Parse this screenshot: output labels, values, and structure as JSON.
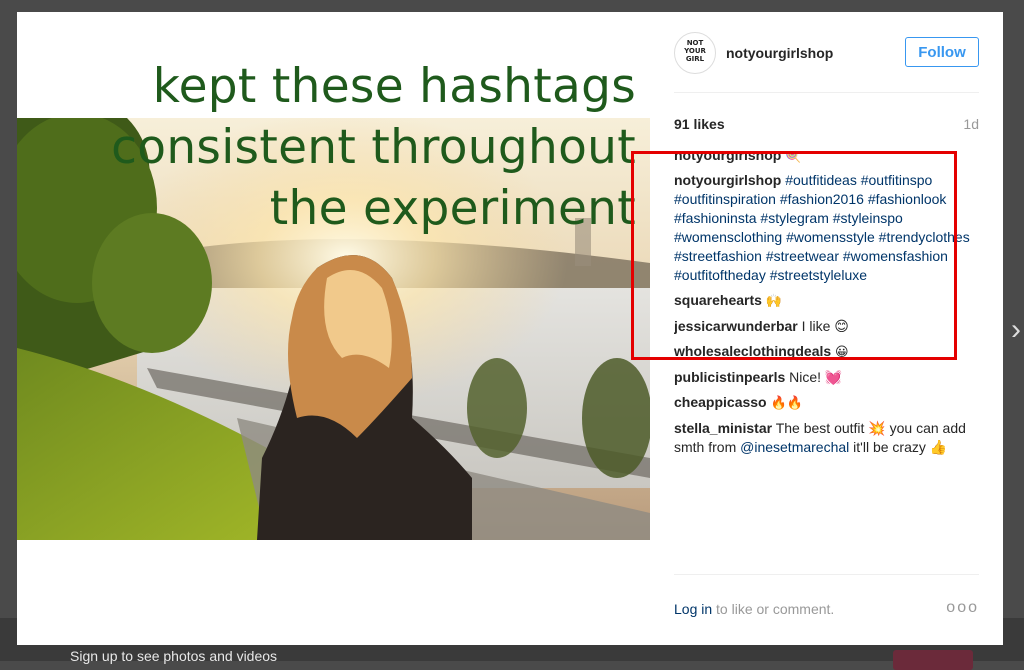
{
  "overlay_text": "kept these hashtags consistent throughout the experiment",
  "overlay_lines": [
    "kept these hashtags",
    "consistent throughout",
    "the experiment"
  ],
  "post": {
    "avatar_text": "NOT YOUR GIRL",
    "username": "notyourgirlshop",
    "follow_label": "Follow",
    "likes": "91 likes",
    "age": "1d"
  },
  "first_comment": {
    "user": "notyourgirlshop",
    "text": "🍭"
  },
  "caption": {
    "user": "notyourgirlshop",
    "hashtags": [
      "#outfitideas",
      "#outfitinspo",
      "#outfitinspiration",
      "#fashion2016",
      "#fashionlook",
      "#fashioninsta",
      "#stylegram",
      "#styleinspo",
      "#womensclothing",
      "#womensstyle",
      "#trendyclothes",
      "#streetfashion",
      "#streetwear",
      "#womensfashion",
      "#outfitoftheday",
      "#streetstyleluxe"
    ]
  },
  "comments": [
    {
      "user": "squarehearts",
      "text": "🙌"
    },
    {
      "user": "jessicarwunderbar",
      "text": "I like 😊"
    },
    {
      "user": "wholesaleclothingdeals",
      "text": "😀"
    },
    {
      "user": "publicistinpearls",
      "text": "Nice! 💓"
    },
    {
      "user": "cheappicasso",
      "text": "🔥🔥"
    },
    {
      "user": "stella_ministar",
      "text_before": "The best outfit 💥 you can add smth from",
      "mention": "@inesetmarechal",
      "text_after": "it'll be crazy 👍"
    }
  ],
  "footer": {
    "login_link": "Log in",
    "login_rest": "to like or comment.",
    "more": "ooo"
  },
  "backdrop": {
    "signup_text": "Sign up to see photos and videos"
  },
  "colors": {
    "highlight_box": "#e40000",
    "headline": "#1f5a1c",
    "follow": "#3897f0",
    "link": "#003569"
  }
}
